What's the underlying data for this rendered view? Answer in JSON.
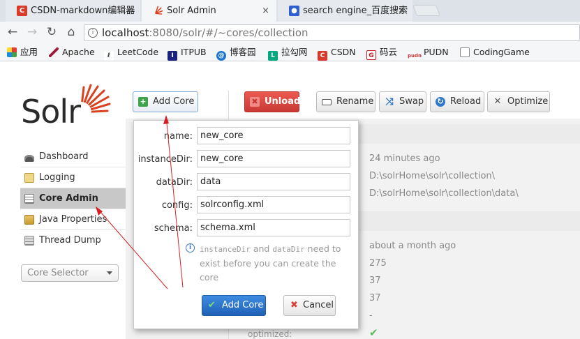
{
  "browser": {
    "tabs": [
      {
        "title": "CSDN-markdown编辑器",
        "favicon": "csdn-icon",
        "color": "#d93b2b",
        "active": false
      },
      {
        "title": "Solr Admin",
        "favicon": "solr-icon",
        "color": "#d9411e",
        "active": true
      },
      {
        "title": "search engine_百度搜索",
        "favicon": "baidu-paw-icon",
        "color": "#2f5fd1",
        "active": false
      }
    ],
    "close_glyph": "×",
    "url_host": "localhost",
    "url_path": ":8080/solr/#/~cores/collection",
    "bookmarks": [
      {
        "label": "应用",
        "icon": "apps-grid-icon"
      },
      {
        "label": "Apache",
        "icon": "apache-feather-icon"
      },
      {
        "label": "LeetCode",
        "icon": "leetcode-icon"
      },
      {
        "label": "ITPUB",
        "icon": "itpub-icon"
      },
      {
        "label": "博客园",
        "icon": "cnblogs-icon"
      },
      {
        "label": "拉勾网",
        "icon": "lagou-icon"
      },
      {
        "label": "CSDN",
        "icon": "csdn-icon"
      },
      {
        "label": "码云",
        "icon": "gitee-icon"
      },
      {
        "label": "PUDN",
        "icon": "pudn-icon"
      },
      {
        "label": "CodingGame",
        "icon": "page-icon"
      }
    ]
  },
  "sidebar": {
    "logo": "Solr",
    "items": [
      {
        "label": "Dashboard",
        "icon": "dashboard-icon"
      },
      {
        "label": "Logging",
        "icon": "logging-icon"
      },
      {
        "label": "Core Admin",
        "icon": "core-admin-icon",
        "active": true
      },
      {
        "label": "Java Properties",
        "icon": "java-icon"
      },
      {
        "label": "Thread Dump",
        "icon": "thread-dump-icon"
      }
    ],
    "core_selector": "Core Selector"
  },
  "toolbar": {
    "add_core": "Add Core",
    "unload": "Unload",
    "rename": "Rename",
    "swap": "Swap",
    "reload": "Reload",
    "optimize": "Optimize"
  },
  "popup": {
    "fields": [
      {
        "label": "name:",
        "value": "new_core"
      },
      {
        "label": "instanceDir:",
        "value": "new_core"
      },
      {
        "label": "dataDir:",
        "value": "data"
      },
      {
        "label": "config:",
        "value": "solrconfig.xml"
      },
      {
        "label": "schema:",
        "value": "schema.xml"
      }
    ],
    "hint_code1": "instanceDir",
    "hint_and": " and ",
    "hint_code2": "dataDir",
    "hint_rest": " need to exist before you can create the core",
    "add_button": "Add Core",
    "cancel_button": "Cancel"
  },
  "core_info": {
    "start_time": "24 minutes ago",
    "instance_dir": "D:\\solrHome\\solr\\collection\\",
    "data_dir": "D:\\solrHome\\solr\\collection\\data\\",
    "last_modified": "about a month ago",
    "num_docs": "275",
    "max_doc": "37",
    "deleted_docs": "37",
    "dash": "-",
    "optimized_label": "optimized:"
  },
  "colors": {
    "accent": "#d9411e",
    "unload": "#d9403a",
    "primary": "#2a6fc7"
  }
}
